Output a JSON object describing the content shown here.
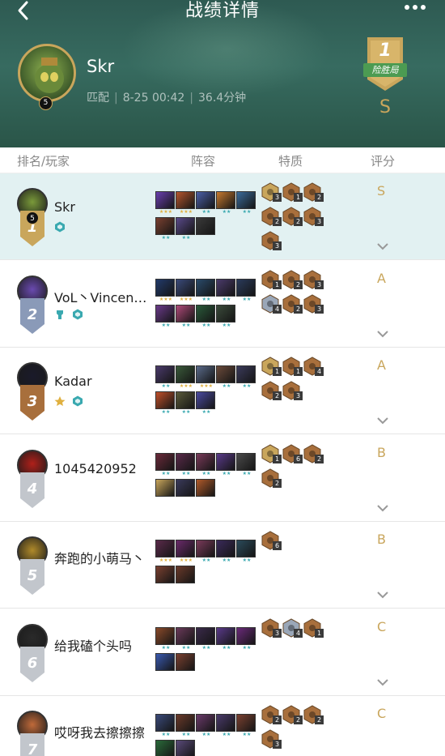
{
  "header": {
    "title": "战绩详情",
    "back_icon": "chevron-left-icon",
    "more_icon": "more-dots-icon"
  },
  "hero": {
    "name": "Skr",
    "level": "5",
    "mode": "匹配",
    "datetime": "8-25 00:42",
    "duration": "36.4分钟",
    "rank": "1",
    "rank_label": "险胜局",
    "grade": "S"
  },
  "columns": [
    "排名/玩家",
    "阵容",
    "特质",
    "评分"
  ],
  "players": [
    {
      "rank": "1",
      "name": "Skr",
      "level": "5",
      "grade": "S",
      "highlight": true,
      "tags": [
        "hex-badge-icon"
      ],
      "champs_row1": [
        {
          "c": "#6a3fb0",
          "s": "★★★"
        },
        {
          "c": "#b5562e",
          "s": "★★★"
        },
        {
          "c": "#4b5fa8",
          "s": "★★"
        },
        {
          "c": "#c77a2f",
          "s": "★★"
        },
        {
          "c": "#3a6b9a",
          "s": "★★"
        }
      ],
      "champs_row2": [
        {
          "c": "#7a4030",
          "s": "★★"
        },
        {
          "c": "#5a4a8a",
          "s": "★★"
        },
        {
          "c": "#3a3a3a",
          "s": ""
        }
      ],
      "traits": [
        {
          "t": "gold",
          "n": "3"
        },
        {
          "t": "bronze",
          "n": "1"
        },
        {
          "t": "bronze",
          "n": "2"
        },
        {
          "t": "bronze",
          "n": "2"
        },
        {
          "t": "bronze",
          "n": "2"
        },
        {
          "t": "bronze",
          "n": "3"
        },
        {
          "t": "bronze",
          "n": "3"
        }
      ]
    },
    {
      "rank": "2",
      "name": "VoL丶VincenT…",
      "level": "",
      "grade": "A",
      "highlight": false,
      "tags": [
        "tower-icon",
        "hex-badge-icon"
      ],
      "champs_row1": [
        {
          "c": "#223a6a",
          "s": "★★★"
        },
        {
          "c": "#3a4a7a",
          "s": "★★★"
        },
        {
          "c": "#2a4a6a",
          "s": "★★"
        },
        {
          "c": "#4a3a6a",
          "s": "★★"
        },
        {
          "c": "#2a3a5a",
          "s": "★★"
        }
      ],
      "champs_row2": [
        {
          "c": "#6a3a8a",
          "s": "★★"
        },
        {
          "c": "#b04a7a",
          "s": "★★"
        },
        {
          "c": "#2a5a3a",
          "s": "★★"
        },
        {
          "c": "#3a4a3a",
          "s": "★★"
        }
      ],
      "traits": [
        {
          "t": "bronze",
          "n": "1"
        },
        {
          "t": "bronze",
          "n": "2"
        },
        {
          "t": "bronze",
          "n": "3"
        },
        {
          "t": "silver",
          "n": "4"
        },
        {
          "t": "bronze",
          "n": "2"
        },
        {
          "t": "bronze",
          "n": "3"
        }
      ]
    },
    {
      "rank": "3",
      "name": "Kadar",
      "level": "",
      "grade": "A",
      "highlight": false,
      "tags": [
        "star-badge-icon",
        "hex-badge-icon"
      ],
      "champs_row1": [
        {
          "c": "#4a3a6a",
          "s": "★★"
        },
        {
          "c": "#3a5a3a",
          "s": "★★★"
        },
        {
          "c": "#5a6a8a",
          "s": "★★★"
        },
        {
          "c": "#6a4a3a",
          "s": "★★"
        },
        {
          "c": "#3a3a5a",
          "s": "★★"
        }
      ],
      "champs_row2": [
        {
          "c": "#c0502a",
          "s": "★★"
        },
        {
          "c": "#5a5a3a",
          "s": "★★"
        },
        {
          "c": "#4a4aa0",
          "s": "★★"
        }
      ],
      "traits": [
        {
          "t": "gold",
          "n": "1"
        },
        {
          "t": "bronze",
          "n": "1"
        },
        {
          "t": "bronze",
          "n": "4"
        },
        {
          "t": "bronze",
          "n": "2"
        },
        {
          "t": "bronze",
          "n": "3"
        }
      ]
    },
    {
      "rank": "4",
      "name": "1045420952",
      "level": "",
      "grade": "B",
      "highlight": false,
      "tags": [],
      "champs_row1": [
        {
          "c": "#6a2a3a",
          "s": "★★"
        },
        {
          "c": "#5a2a4a",
          "s": "★★"
        },
        {
          "c": "#7a3a5a",
          "s": "★★"
        },
        {
          "c": "#5a3a8a",
          "s": "★★"
        },
        {
          "c": "#4a4a4a",
          "s": "★★"
        }
      ],
      "champs_row2": [
        {
          "c": "#c9a65c",
          "s": ""
        },
        {
          "c": "#3a3a5a",
          "s": ""
        },
        {
          "c": "#b05a2a",
          "s": ""
        }
      ],
      "traits": [
        {
          "t": "gold",
          "n": "1"
        },
        {
          "t": "bronze",
          "n": "6"
        },
        {
          "t": "bronze",
          "n": "2"
        },
        {
          "t": "bronze",
          "n": "2"
        }
      ]
    },
    {
      "rank": "5",
      "name": "奔跑的小萌马丶",
      "level": "",
      "grade": "B",
      "highlight": false,
      "tags": [],
      "champs_row1": [
        {
          "c": "#5a2a4a",
          "s": "★★★"
        },
        {
          "c": "#6a2a6a",
          "s": "★★★"
        },
        {
          "c": "#7a3a5a",
          "s": "★★"
        },
        {
          "c": "#3a2a5a",
          "s": "★★"
        },
        {
          "c": "#2a4a5a",
          "s": "★★"
        }
      ],
      "champs_row2": [
        {
          "c": "#7a4030",
          "s": ""
        },
        {
          "c": "#6a3a2a",
          "s": ""
        }
      ],
      "traits": [
        {
          "t": "bronze",
          "n": "6"
        }
      ]
    },
    {
      "rank": "6",
      "name": "给我磕个头吗",
      "level": "",
      "grade": "C",
      "highlight": false,
      "tags": [],
      "champs_row1": [
        {
          "c": "#8a4a2a",
          "s": "★★"
        },
        {
          "c": "#6a3a5a",
          "s": "★★"
        },
        {
          "c": "#3a2a4a",
          "s": "★★"
        },
        {
          "c": "#5a3a8a",
          "s": "★★"
        },
        {
          "c": "#6a2a7a",
          "s": "★★"
        }
      ],
      "champs_row2": [
        {
          "c": "#3a5ab0",
          "s": ""
        },
        {
          "c": "#7a4030",
          "s": ""
        }
      ],
      "traits": [
        {
          "t": "bronze",
          "n": "3"
        },
        {
          "t": "silver",
          "n": "4"
        },
        {
          "t": "bronze",
          "n": "1"
        }
      ]
    },
    {
      "rank": "7",
      "name": "哎呀我去擦擦擦",
      "level": "",
      "grade": "C",
      "highlight": false,
      "tags": [],
      "champs_row1": [
        {
          "c": "#3a4a7a",
          "s": "★★"
        },
        {
          "c": "#6a3a2a",
          "s": "★★"
        },
        {
          "c": "#6a3a6a",
          "s": "★★"
        },
        {
          "c": "#4a3a6a",
          "s": "★★"
        },
        {
          "c": "#7a4030",
          "s": "★★"
        }
      ],
      "champs_row2": [
        {
          "c": "#2a6a3a",
          "s": ""
        },
        {
          "c": "#5a4a7a",
          "s": ""
        }
      ],
      "traits": [
        {
          "t": "bronze",
          "n": "2"
        },
        {
          "t": "bronze",
          "n": "2"
        },
        {
          "t": "bronze",
          "n": "2"
        },
        {
          "t": "bronze",
          "n": "3"
        }
      ]
    }
  ],
  "colors": {
    "gold": "#c9a65c",
    "bronze": "#a86f3c",
    "silver": "#9aa7b8",
    "highlight": "#e2f1f2",
    "teal": "#3aa9b0"
  }
}
